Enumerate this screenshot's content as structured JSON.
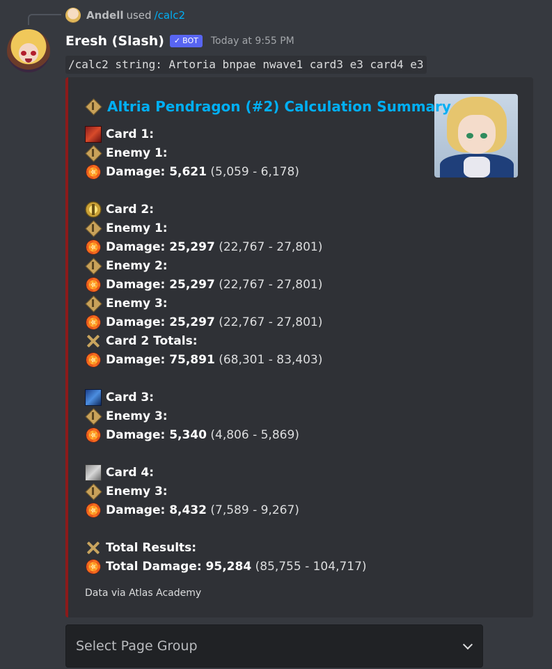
{
  "reply": {
    "user": "Andell",
    "verb": "used",
    "command": "/calc2"
  },
  "message": {
    "author": "Eresh (Slash)",
    "bot_tag": "BOT",
    "timestamp": "Today at 9:55 PM",
    "command_text": "/calc2 string: Artoria bnpae nwave1 card3 e3 card4 e3"
  },
  "embed": {
    "accent_color": "#8b1a1a",
    "title": "Altria Pendragon (#2) Calculation Summary",
    "title_icon": "np-diamond-icon",
    "lines": [
      {
        "icon": "card1",
        "label": "Card 1:",
        "value": "",
        "range": ""
      },
      {
        "icon": "diamond",
        "label": "Enemy 1:",
        "value": "",
        "range": ""
      },
      {
        "icon": "damage",
        "label": "Damage: ",
        "value": "5,621",
        "range": "(5,059 - 6,178)"
      },
      {
        "icon": "card2",
        "label": "Card 2:",
        "value": "",
        "range": ""
      },
      {
        "icon": "diamond",
        "label": "Enemy 1:",
        "value": "",
        "range": ""
      },
      {
        "icon": "damage",
        "label": "Damage: ",
        "value": "25,297",
        "range": "(22,767 - 27,801)"
      },
      {
        "icon": "diamond",
        "label": "Enemy 2:",
        "value": "",
        "range": ""
      },
      {
        "icon": "damage",
        "label": "Damage: ",
        "value": "25,297",
        "range": "(22,767 - 27,801)"
      },
      {
        "icon": "diamond",
        "label": "Enemy 3:",
        "value": "",
        "range": ""
      },
      {
        "icon": "damage",
        "label": "Damage: ",
        "value": "25,297",
        "range": "(22,767 - 27,801)"
      },
      {
        "icon": "swords",
        "label": "Card 2 Totals:",
        "value": "",
        "range": ""
      },
      {
        "icon": "damage",
        "label": "Damage: ",
        "value": "75,891",
        "range": "(68,301 - 83,403)"
      },
      {
        "icon": "card3",
        "label": "Card 3:",
        "value": "",
        "range": ""
      },
      {
        "icon": "diamond",
        "label": "Enemy 3:",
        "value": "",
        "range": ""
      },
      {
        "icon": "damage",
        "label": "Damage: ",
        "value": "5,340",
        "range": "(4,806 - 5,869)"
      },
      {
        "icon": "card4",
        "label": "Card 4:",
        "value": "",
        "range": ""
      },
      {
        "icon": "diamond",
        "label": "Enemy 3:",
        "value": "",
        "range": ""
      },
      {
        "icon": "damage",
        "label": "Damage: ",
        "value": "8,432",
        "range": "(7,589 - 9,267)"
      },
      {
        "icon": "swords",
        "label": "Total Results:",
        "value": "",
        "range": ""
      },
      {
        "icon": "damage",
        "label": "Total Damage: ",
        "value": "95,284",
        "range": "(85,755 - 104,717)"
      }
    ],
    "footer": "Data via Atlas Academy"
  },
  "select": {
    "placeholder": "Select Page Group"
  }
}
